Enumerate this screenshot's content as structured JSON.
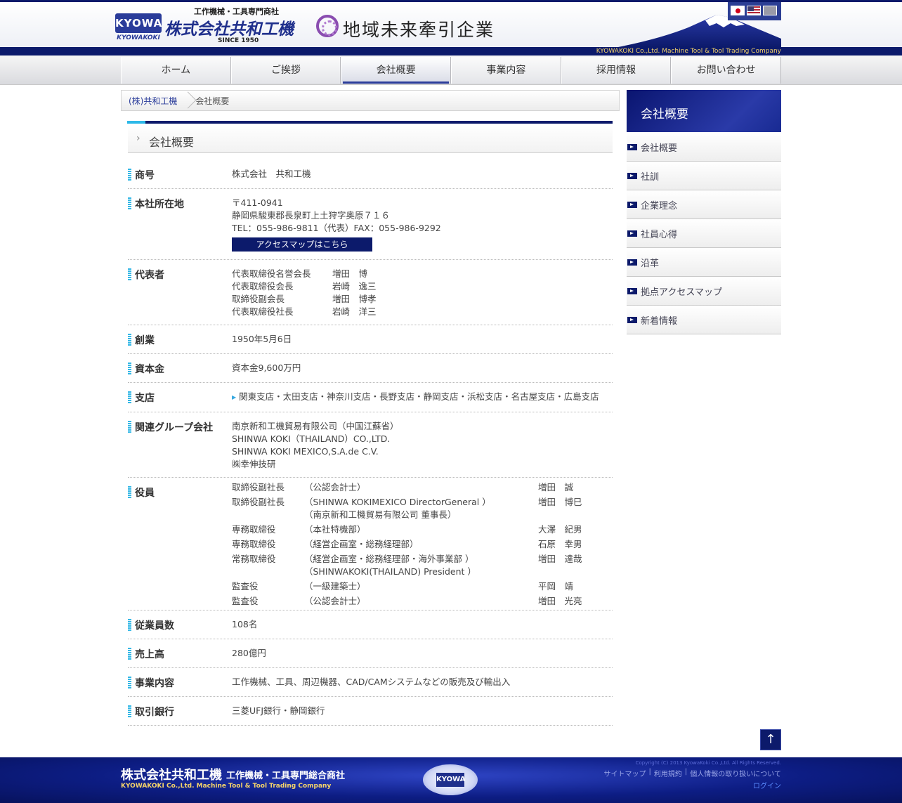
{
  "header": {
    "logo_mark": "KYOWA",
    "logo_sub": "KYOWAKOKI",
    "company_tag": "工作機械・工具専門商社",
    "company_name": "株式会社共和工機",
    "since": "SINCE 1950",
    "region_label": "地域未来牽引企業",
    "tagline": "KYOWAKOKI Co.,Ltd. Machine Tool & Tool Trading Company",
    "languages": [
      "jp",
      "us",
      "cn"
    ]
  },
  "nav": {
    "items": [
      {
        "label": "ホーム"
      },
      {
        "label": "ご挨拶"
      },
      {
        "label": "会社概要"
      },
      {
        "label": "事業内容"
      },
      {
        "label": "採用情報"
      },
      {
        "label": "お問い合わせ"
      }
    ],
    "active": "会社概要"
  },
  "breadcrumb": {
    "home": "(株)共和工機",
    "current": "会社概要"
  },
  "page_title": "会社概要",
  "info": {
    "trade_name": {
      "label": "商号",
      "value": "株式会社　共和工機"
    },
    "address": {
      "label": "本社所在地",
      "postal": "〒411-0941",
      "line": "静岡県駿東郡長泉町上土狩字奥原７１６",
      "tel": "TEL：055-986-9811（代表）FAX：055-986-9292",
      "map_button": "アクセスマップはこちら"
    },
    "representatives": {
      "label": "代表者",
      "people": [
        {
          "title": "代表取締役名誉会長",
          "name": "増田　博"
        },
        {
          "title": "代表取締役会長",
          "name": "岩崎　逸三"
        },
        {
          "title": "取締役副会長",
          "name": "増田　博孝"
        },
        {
          "title": "代表取締役社長",
          "name": "岩崎　洋三"
        }
      ]
    },
    "founded": {
      "label": "創業",
      "value": "1950年5月6日"
    },
    "capital": {
      "label": "資本金",
      "value": "資本金9,600万円"
    },
    "branches": {
      "label": "支店",
      "value": "関東支店・太田支店・神奈川支店・長野支店・静岡支店・浜松支店・名古屋支店・広島支店"
    },
    "group": {
      "label": "関連グループ会社",
      "companies": [
        "南京新和工機貿易有限公司（中国江蘇省）",
        "SHINWA KOKI（THAILAND）CO.,LTD.",
        "SHINWA KOKI MEXICO,S.A.de C.V.",
        "㈱幸伸技研"
      ]
    },
    "officers": {
      "label": "役員",
      "list": [
        {
          "title": "取締役副社長",
          "dept": "（公認会計士）",
          "dept2": "",
          "name": "増田　誠"
        },
        {
          "title": "取締役副社長",
          "dept": "（SHINWA KOKIMEXICO DirectorGeneral ）",
          "dept2": "（南京新和工機貿易有限公司 董事長）",
          "name": "増田　博巳"
        },
        {
          "title": "専務取締役",
          "dept": "（本社特機部）",
          "dept2": "",
          "name": "大澤　紀男"
        },
        {
          "title": "専務取締役",
          "dept": "（経営企画室・総務経理部）",
          "dept2": "",
          "name": "石原　幸男"
        },
        {
          "title": "常務取締役",
          "dept": "（経営企画室・総務経理部・海外事業部 ）",
          "dept2": "（SHINWAKOKI(THAILAND) President ）",
          "name": "増田　達哉"
        },
        {
          "title": "監査役",
          "dept": "（一級建築士）",
          "dept2": "",
          "name": "平岡　靖"
        },
        {
          "title": "監査役",
          "dept": "（公認会計士）",
          "dept2": "",
          "name": "増田　光亮"
        }
      ]
    },
    "employees": {
      "label": "従業員数",
      "value": "108名"
    },
    "sales": {
      "label": "売上高",
      "value": "280億円"
    },
    "business": {
      "label": "事業内容",
      "value": "工作機械、工具、周辺機器、CAD/CAMシステムなどの販売及び輸出入"
    },
    "banks": {
      "label": "取引銀行",
      "value": "三菱UFJ銀行・静岡銀行"
    }
  },
  "sidebar": {
    "title": "会社概要",
    "items": [
      {
        "label": "会社概要"
      },
      {
        "label": "社訓"
      },
      {
        "label": "企業理念"
      },
      {
        "label": "社員心得"
      },
      {
        "label": "沿革"
      },
      {
        "label": "拠点アクセスマップ"
      },
      {
        "label": "新着情報"
      }
    ]
  },
  "to_top": "↑",
  "footer": {
    "name": "株式会社共和工機",
    "tag": "工作機械・工具専門総合商社",
    "en": "KYOWAKOKI Co.,Ltd.  Machine Tool & Tool Trading Company",
    "logo": "KYOWA",
    "copyright": "Copyright (C) 2013 KyowaKoki Co.,Ltd. All Rights Reserved.",
    "links": [
      "サイトマップ",
      "利用規約",
      "個人情報の取り扱いについて"
    ],
    "login": "ログイン"
  },
  "colors": {
    "navy": "#0c1a6b",
    "accent_blue": "#35b8e6",
    "gold": "#f5d46a"
  }
}
